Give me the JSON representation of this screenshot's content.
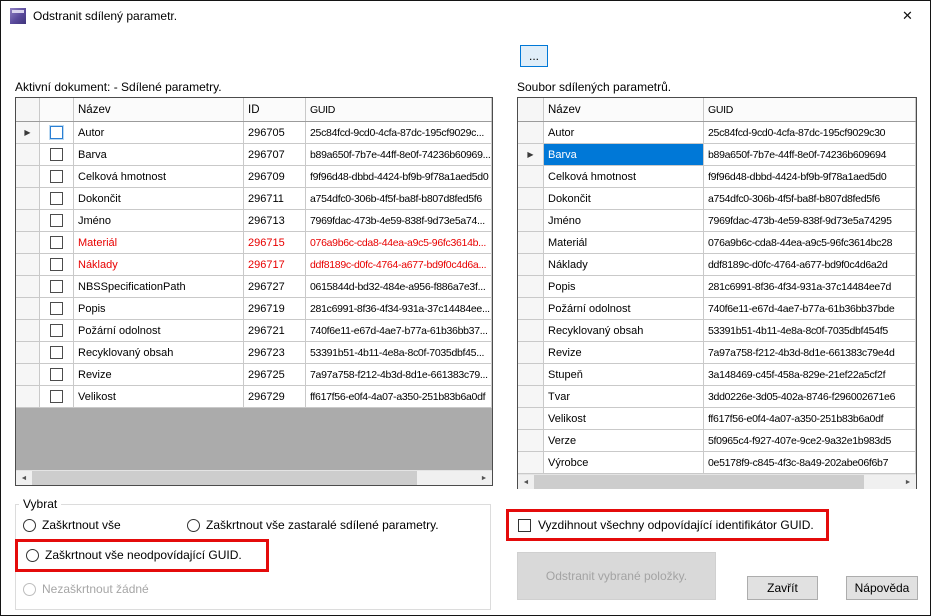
{
  "window": {
    "title": "Odstranit sdílený parametr."
  },
  "icons": {
    "close": "✕",
    "current_row": "▶",
    "scroll_left": "◄",
    "scroll_right": "►"
  },
  "toolbar": {
    "browse_label": "..."
  },
  "left_grid": {
    "label": "Aktivní dokument: - Sdílené parametry.",
    "columns": {
      "name": "Název",
      "id": "ID",
      "guid": "GUID"
    },
    "rows": [
      {
        "name": "Autor",
        "id": "296705",
        "guid": "25c84fcd-9cd0-4cfa-87dc-195cf9029c...",
        "red": false,
        "selector": true,
        "focused": true
      },
      {
        "name": "Barva",
        "id": "296707",
        "guid": "b89a650f-7b7e-44ff-8e0f-74236b60969...",
        "red": false
      },
      {
        "name": "Celková hmotnost",
        "id": "296709",
        "guid": "f9f96d48-dbbd-4424-bf9b-9f78a1aed5d0",
        "red": false
      },
      {
        "name": "Dokončit",
        "id": "296711",
        "guid": "a754dfc0-306b-4f5f-ba8f-b807d8fed5f6",
        "red": false
      },
      {
        "name": "Jméno",
        "id": "296713",
        "guid": "7969fdac-473b-4e59-838f-9d73e5a74...",
        "red": false
      },
      {
        "name": "Materiál",
        "id": "296715",
        "guid": "076a9b6c-cda8-44ea-a9c5-96fc3614b...",
        "red": true
      },
      {
        "name": "Náklady",
        "id": "296717",
        "guid": "ddf8189c-d0fc-4764-a677-bd9f0c4d6a...",
        "red": true
      },
      {
        "name": "NBSSpecificationPath",
        "id": "296727",
        "guid": "0615844d-bd32-484e-a956-f886a7e3f...",
        "red": false
      },
      {
        "name": "Popis",
        "id": "296719",
        "guid": "281c6991-8f36-4f34-931a-37c14484ee...",
        "red": false
      },
      {
        "name": "Požární odolnost",
        "id": "296721",
        "guid": "740f6e11-e67d-4ae7-b77a-61b36bb37...",
        "red": false
      },
      {
        "name": "Recyklovaný obsah",
        "id": "296723",
        "guid": "53391b51-4b11-4e8a-8c0f-7035dbf45...",
        "red": false
      },
      {
        "name": "Revize",
        "id": "296725",
        "guid": "7a97a758-f212-4b3d-8d1e-661383c79...",
        "red": false
      },
      {
        "name": "Velikost",
        "id": "296729",
        "guid": "ff617f56-e0f4-4a07-a350-251b83b6a0df",
        "red": false
      }
    ]
  },
  "right_grid": {
    "label": "Soubor sdílených parametrů.",
    "columns": {
      "name": "Název",
      "guid": "GUID"
    },
    "rows": [
      {
        "name": "Autor",
        "guid": "25c84fcd-9cd0-4cfa-87dc-195cf9029c30"
      },
      {
        "name": "Barva",
        "guid": "b89a650f-7b7e-44ff-8e0f-74236b609694",
        "selected": true
      },
      {
        "name": "Celková hmotnost",
        "guid": "f9f96d48-dbbd-4424-bf9b-9f78a1aed5d0"
      },
      {
        "name": "Dokončit",
        "guid": "a754dfc0-306b-4f5f-ba8f-b807d8fed5f6"
      },
      {
        "name": "Jméno",
        "guid": "7969fdac-473b-4e59-838f-9d73e5a74295"
      },
      {
        "name": "Materiál",
        "guid": "076a9b6c-cda8-44ea-a9c5-96fc3614bc28"
      },
      {
        "name": "Náklady",
        "guid": "ddf8189c-d0fc-4764-a677-bd9f0c4d6a2d"
      },
      {
        "name": "Popis",
        "guid": "281c6991-8f36-4f34-931a-37c14484ee7d"
      },
      {
        "name": "Požární odolnost",
        "guid": "740f6e11-e67d-4ae7-b77a-61b36bb37bde"
      },
      {
        "name": "Recyklovaný obsah",
        "guid": "53391b51-4b11-4e8a-8c0f-7035dbf454f5"
      },
      {
        "name": "Revize",
        "guid": "7a97a758-f212-4b3d-8d1e-661383c79e4d"
      },
      {
        "name": "Stupeň",
        "guid": "3a148469-c45f-458a-829e-21ef22a5cf2f"
      },
      {
        "name": "Tvar",
        "guid": "3dd0226e-3d05-402a-8746-f296002671e6"
      },
      {
        "name": "Velikost",
        "guid": "ff617f56-e0f4-4a07-a350-251b83b6a0df"
      },
      {
        "name": "Verze",
        "guid": "5f0965c4-f927-407e-9ce2-9a32e1b983d5"
      },
      {
        "name": "Výrobce",
        "guid": "0e5178f9-c845-4f3c-8a49-202abe06f6b7"
      }
    ]
  },
  "select_group": {
    "label": "Vybrat",
    "radios": [
      {
        "label": "Zaškrtnout vše",
        "disabled": false,
        "highlighted": false
      },
      {
        "label": "Zaškrtnout vše zastaralé  sdílené parametry.",
        "disabled": false,
        "highlighted": false
      },
      {
        "label": "Zaškrtnout vše neodpovídající GUID.",
        "disabled": false,
        "highlighted": true
      },
      {
        "label": "Nezaškrtnout žádné",
        "disabled": true,
        "highlighted": false
      }
    ]
  },
  "match_checkbox": {
    "label": "Vyzdihnout všechny odpovídající identifikátor GUID.",
    "checked": false,
    "highlighted": true
  },
  "buttons": {
    "remove": "Odstranit vybrané položky.",
    "close": "Zavřít",
    "help": "Nápověda"
  },
  "colors": {
    "selection": "#0078d7",
    "mismatch_text": "#e80000",
    "annotation": "#e40b0b"
  }
}
